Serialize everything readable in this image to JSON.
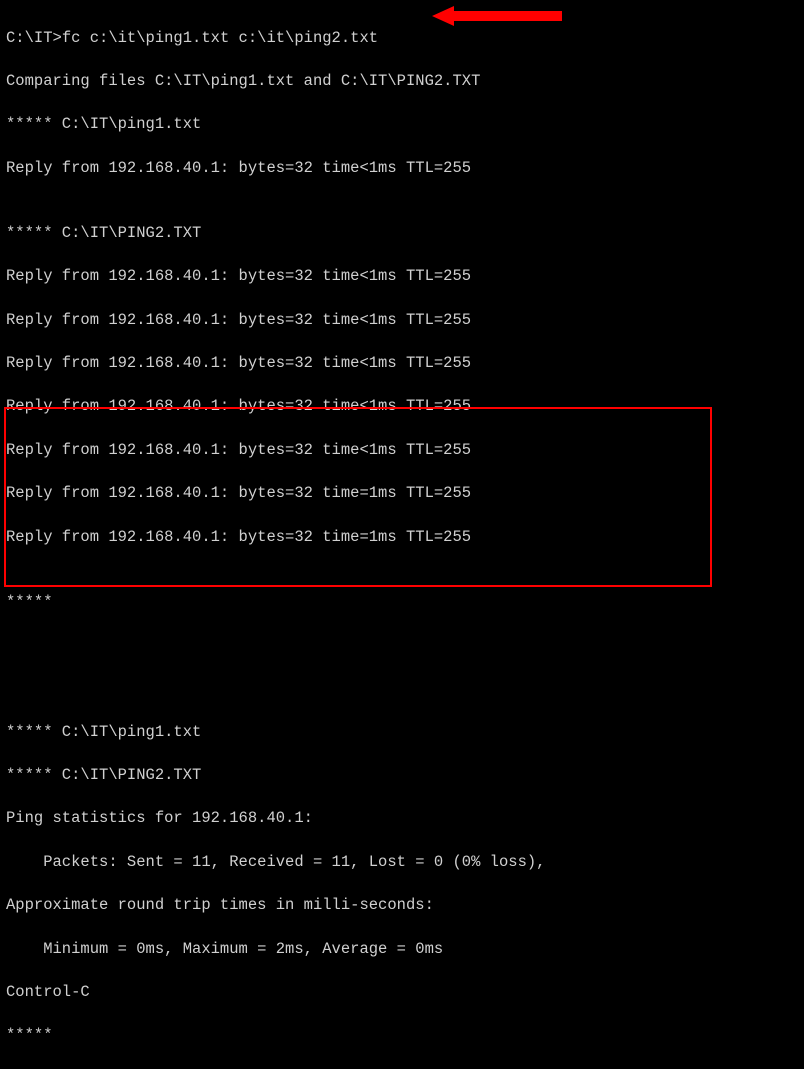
{
  "prompt": "C:\\IT>",
  "command": "fc c:\\it\\ping1.txt c:\\it\\ping2.txt",
  "comparing": "Comparing files C:\\IT\\ping1.txt and C:\\IT\\PING2.TXT",
  "sep1": "***** C:\\IT\\ping1.txt",
  "reply1": "Reply from 192.168.40.1: bytes=32 time<1ms TTL=255",
  "blank": "",
  "sep2": "***** C:\\IT\\PING2.TXT",
  "r2_1": "Reply from 192.168.40.1: bytes=32 time<1ms TTL=255",
  "r2_2": "Reply from 192.168.40.1: bytes=32 time<1ms TTL=255",
  "r2_3": "Reply from 192.168.40.1: bytes=32 time<1ms TTL=255",
  "r2_4": "Reply from 192.168.40.1: bytes=32 time<1ms TTL=255",
  "r2_5": "Reply from 192.168.40.1: bytes=32 time<1ms TTL=255",
  "r2_6": "Reply from 192.168.40.1: bytes=32 time=1ms TTL=255",
  "r2_7": "Reply from 192.168.40.1: bytes=32 time=1ms TTL=255",
  "stars": "*****",
  "box_sep1": "***** C:\\IT\\ping1.txt",
  "box_sep2": "***** C:\\IT\\PING2.TXT",
  "stats_header": "Ping statistics for 192.168.40.1:",
  "stats_packets": "    Packets: Sent = 11, Received = 11, Lost = 0 (0% loss),",
  "approx": "Approximate round trip times in milli-seconds:",
  "minmax": "    Minimum = 0ms, Maximum = 2ms, Average = 0ms",
  "ctrlc": "Control-C",
  "end_stars": "*****",
  "arrow_color": "#ff0000"
}
